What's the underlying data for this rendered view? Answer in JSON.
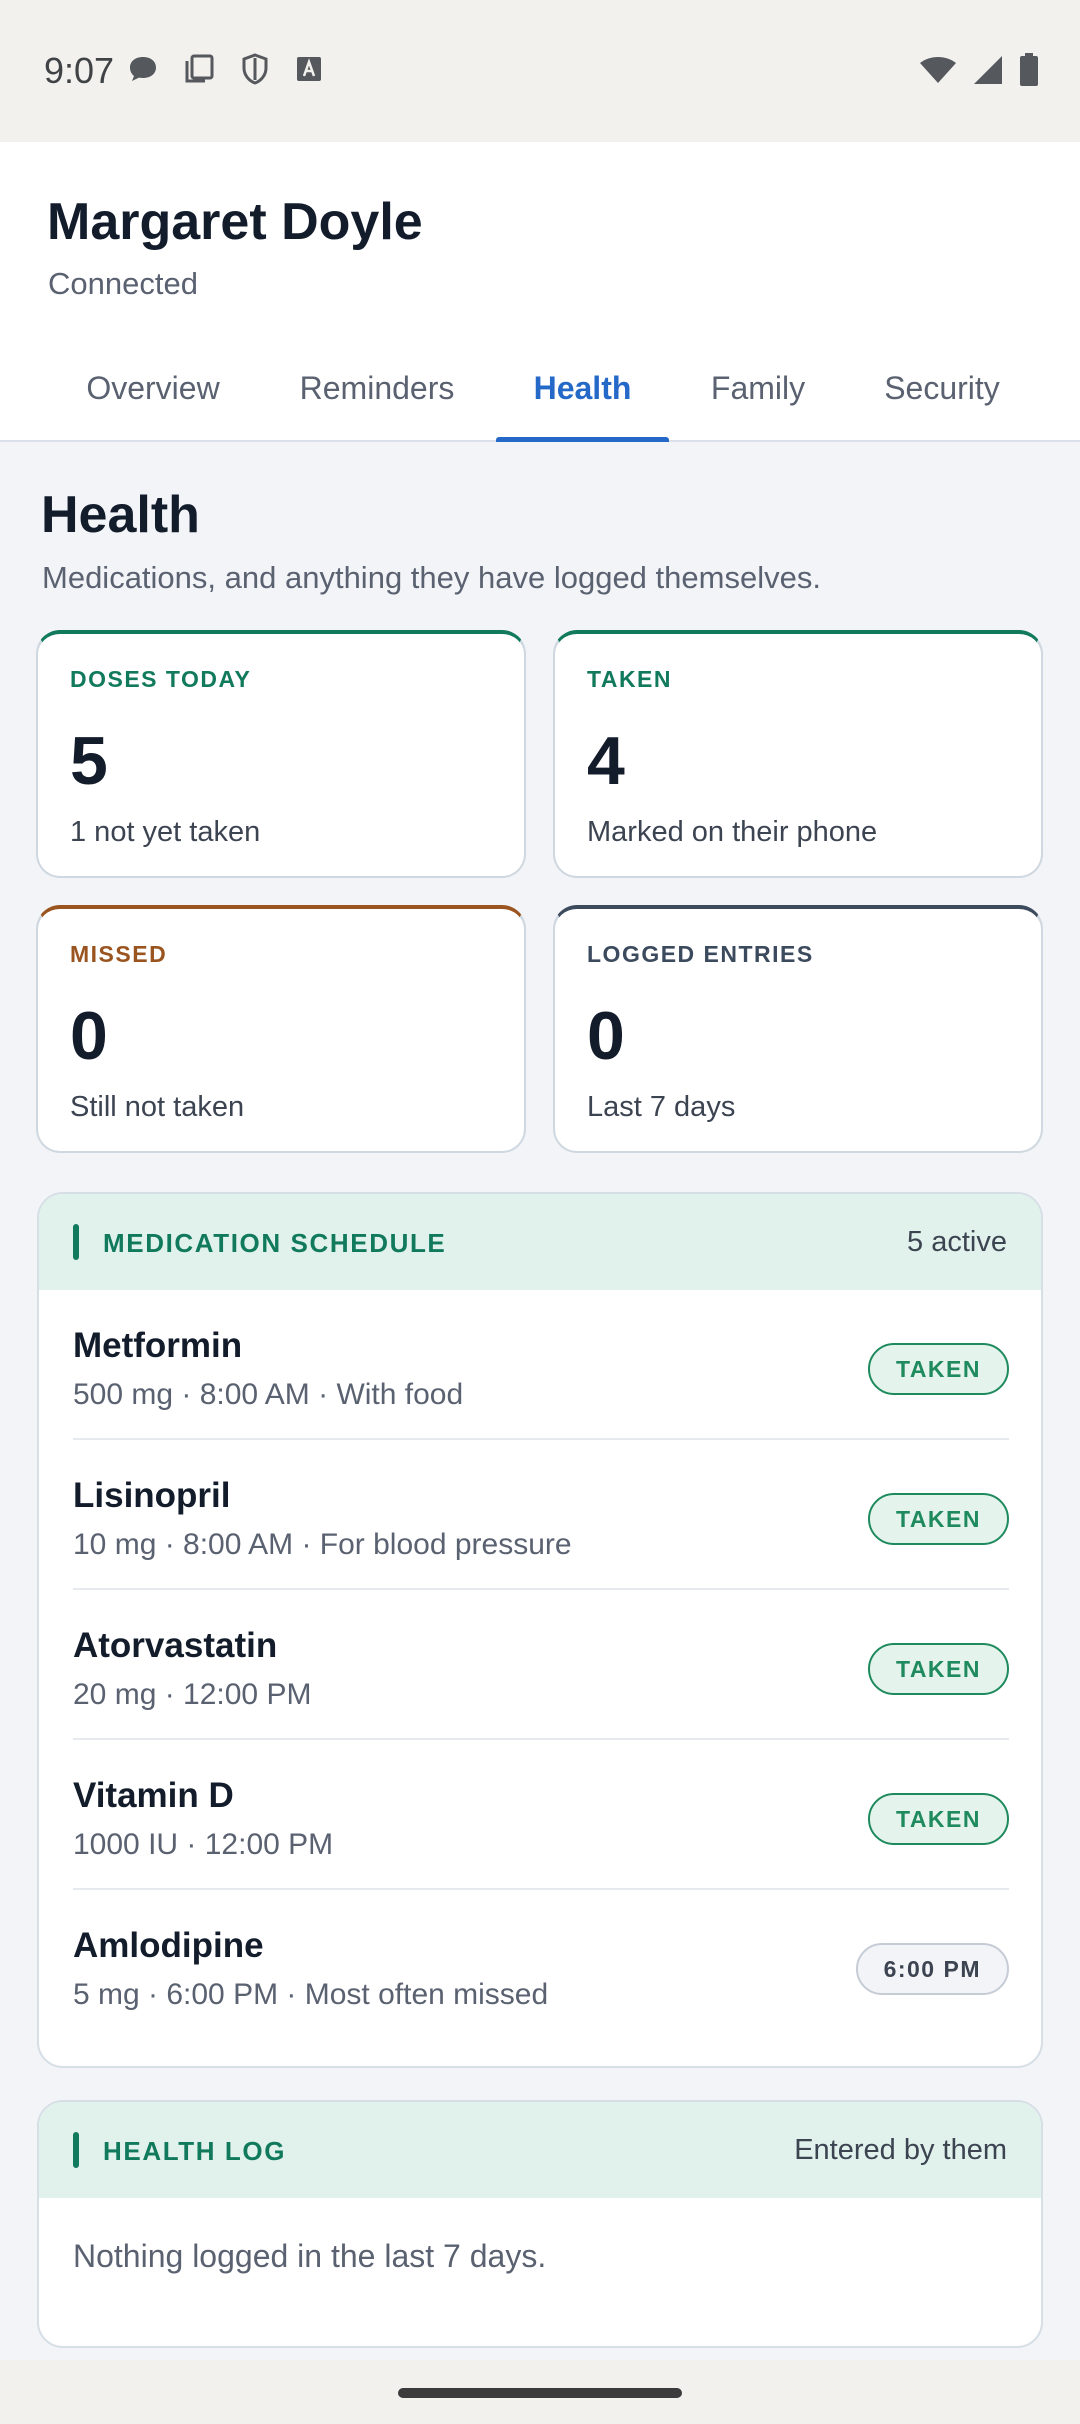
{
  "status_bar": {
    "time": "9:07",
    "left_icons": [
      "chat-bubble-icon",
      "copy-icon",
      "shield-icon",
      "a-box-icon"
    ],
    "right_icons": [
      "wifi-icon",
      "cell-signal-icon",
      "battery-icon"
    ]
  },
  "header": {
    "name": "Margaret Doyle",
    "status": "Connected"
  },
  "tabs": [
    {
      "label": "Overview",
      "active": false
    },
    {
      "label": "Reminders",
      "active": false
    },
    {
      "label": "Health",
      "active": true
    },
    {
      "label": "Family",
      "active": false
    },
    {
      "label": "Security",
      "active": false
    }
  ],
  "section": {
    "title": "Health",
    "description": "Medications, and anything they have logged themselves."
  },
  "stats": [
    {
      "label": "DOSES TODAY",
      "value": "5",
      "sub": "1 not yet taken",
      "color": "#127a5c"
    },
    {
      "label": "TAKEN",
      "value": "4",
      "sub": "Marked on their phone",
      "color": "#127a5c"
    },
    {
      "label": "MISSED",
      "value": "0",
      "sub": "Still not taken",
      "color": "#9a5420"
    },
    {
      "label": "LOGGED ENTRIES",
      "value": "0",
      "sub": "Last 7 days",
      "color": "#3c4a5e"
    }
  ],
  "medication_schedule": {
    "title": "MEDICATION SCHEDULE",
    "meta": "5 active",
    "items": [
      {
        "name": "Metformin",
        "detail": "500 mg · 8:00 AM · With food",
        "badge": "TAKEN",
        "state": "taken"
      },
      {
        "name": "Lisinopril",
        "detail": "10 mg · 8:00 AM · For blood pressure",
        "badge": "TAKEN",
        "state": "taken"
      },
      {
        "name": "Atorvastatin",
        "detail": "20 mg · 12:00 PM",
        "badge": "TAKEN",
        "state": "taken"
      },
      {
        "name": "Vitamin D",
        "detail": "1000 IU · 12:00 PM",
        "badge": "TAKEN",
        "state": "taken"
      },
      {
        "name": "Amlodipine",
        "detail": "5 mg · 6:00 PM · Most often missed",
        "badge": "6:00 PM",
        "state": "pending"
      }
    ]
  },
  "health_log": {
    "title": "HEALTH LOG",
    "meta": "Entered by them",
    "empty_text": "Nothing logged in the last 7 days."
  },
  "colors": {
    "accent_blue": "#2468c8",
    "accent_green": "#127a5c",
    "panel_head_bg": "#e1f2ec"
  }
}
